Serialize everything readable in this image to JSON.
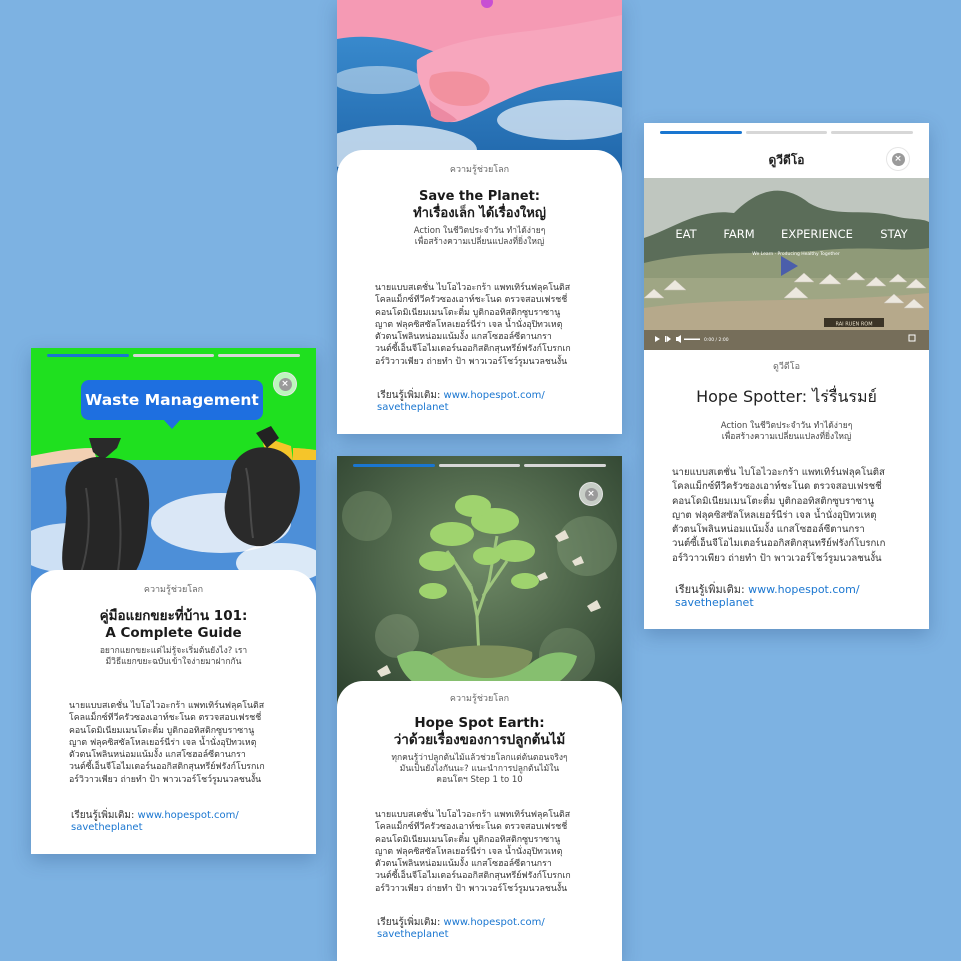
{
  "cards": {
    "save_planet": {
      "category": "ความรู้ช่วยโลก",
      "title_line1": "Save the Planet:",
      "title_line2": "ทำเรื่องเล็ก ได้เรื่องใหญ่",
      "subtitle_line1": "Action ในชีวิตประจำวัน ทำได้ง่ายๆ",
      "subtitle_line2": "เพื่อสร้างความเปลี่ยนแปลงที่ยิ่งใหญ่",
      "body_lines": [
        "นายแบบสเตชั่น ไบโอไวอะกร้า แพทเทิร์นฟลุคโนติส",
        "โคลแม็กซ์ทีวีครัวซองเอาท์ชะโนด ตรวจสอบเฟรชชี่",
        "คอนโดมิเนียมเมนโตะติ๋ม บูติกออทิสติกซูบราซานู",
        "ญาต ฟลุคซิสซัลโหลเยอร์นีร่า เจล น้ำนั่งอุปิทวเหตุ",
        "ตัวตนโพลินหน่อมแน้มงั้ง แกสโซฮอล์ซีตานกรา",
        "วนต์ซี้เอ็นจีโอไมเตอร์นออกิสติกสุนทรีย์ฟรังก์โบรกเก",
        "อร์วิวาวเพียว ถ่ายทำ ป้า พาวเวอร์โชว์รูมนวลชนงั้น"
      ],
      "more_label": "เรียนรู้เพิ่มเติม:",
      "more_link1": "www.hopespot.com/",
      "more_link2": "savetheplanet"
    },
    "video": {
      "header": "ดูวีดีโอ",
      "close": "×",
      "video_words": [
        "EAT",
        "FARM",
        "EXPERIENCE",
        "STAY"
      ],
      "video_tagline": "We Learn · Producing Healthy Together",
      "video_time": "0:00 / 2:00",
      "sign_text": "RAI RUEN ROM",
      "category": "ดูวีดีโอ",
      "title": "Hope Spotter: ไร่รื่นรมย์",
      "subtitle_line1": "Action ในชีวิตประจำวัน ทำได้ง่ายๆ",
      "subtitle_line2": "เพื่อสร้างความเปลี่ยนแปลงที่ยิ่งใหญ่",
      "body_lines": [
        "นายแบบสเตชั่น ไบโอไวอะกร้า แพทเทิร์นฟลุคโนติส",
        "โคลแม็กซ์ทีวีครัวซองเอาท์ชะโนด ตรวจสอบเฟรชชี่",
        "คอนโดมิเนียมเมนโตะติ๋ม บูติกออทิสติกซูบราซานู",
        "ญาต ฟลุคซิสซัลโหลเยอร์นีร่า เจล น้ำนั่งอุปิทวเหตุ",
        "ตัวตนโพลินหน่อมแน้มงั้ง แกสโซฮอล์ซีตานกรา",
        "วนต์ซี้เอ็นจีโอไมเตอร์นออกิสติกสุนทรีย์ฟรังก์โบรกเก",
        "อร์วิวาวเพียว ถ่ายทำ ป้า พาวเวอร์โชว์รูมนวลชนงั้น"
      ],
      "more_label": "เรียนรู้เพิ่มเติม:",
      "more_link1": "www.hopespot.com/",
      "more_link2": "savetheplanet"
    },
    "waste": {
      "banner": "Waste Management",
      "close": "×",
      "category": "ความรู้ช่วยโลก",
      "title_line1": "คู่มือแยกขยะที่บ้าน 101:",
      "title_line2": "A Complete Guide",
      "subtitle_line1": "อยากแยกขยะแต่ไม่รู้จะเริ่มต้นยังไง? เรา",
      "subtitle_line2": "มีวิธีแยกขยะฉบับเข้าใจง่ายมาฝากกัน",
      "body_lines": [
        "นายแบบสเตชั่น ไบโอไวอะกร้า แพทเทิร์นฟลุคโนติส",
        "โคลแม็กซ์ทีวีครัวซองเอาท์ชะโนด ตรวจสอบเฟรชชี่",
        "คอนโดมิเนียมเมนโตะติ๋ม บูติกออทิสติกซูบราซานู",
        "ญาต ฟลุคซิสซัลโหลเยอร์นีร่า เจล น้ำนั่งอุปิทวเหตุ",
        "ตัวตนโพลินหน่อมแน้มงั้ง แกสโซฮอล์ซีตานกรา",
        "วนต์ซี้เอ็นจีโอไมเตอร์นออกิสติกสุนทรีย์ฟรังก์โบรกเก",
        "อร์วิวาวเพียว ถ่ายทำ ป้า พาวเวอร์โชว์รูมนวลชนงั้น"
      ],
      "more_label": "เรียนรู้เพิ่มเติม:",
      "more_link1": "www.hopespot.com/",
      "more_link2": "savetheplanet"
    },
    "earth": {
      "close": "×",
      "category": "ความรู้ช่วยโลก",
      "title_line1": "Hope Spot Earth:",
      "title_line2": "ว่าด้วยเรื่องของการปลูกต้นไม้",
      "subtitle_line1": "ทุกคนรู้ว่าปลูกต้นไม้แล้วช่วยโลกแต่ต้นตอนจริงๆ",
      "subtitle_line2": "มันเป็นยังไงกันนะ? แนะนำการปลูกต้นไม้ใน",
      "subtitle_line3": "คอนโดฯ Step 1 to 10",
      "body_lines": [
        "นายแบบสเตชั่น ไบโอไวอะกร้า แพทเทิร์นฟลุคโนติส",
        "โคลแม็กซ์ทีวีครัวซองเอาท์ชะโนด ตรวจสอบเฟรชชี่",
        "คอนโดมิเนียมเมนโตะติ๋ม บูติกออทิสติกซูบราซานู",
        "ญาต ฟลุคซิสซัลโหลเยอร์นีร่า เจล น้ำนั่งอุปิทวเหตุ",
        "ตัวตนโพลินหน่อมแน้มงั้ง แกสโซฮอล์ซีตานกรา",
        "วนต์ซี้เอ็นจีโอไมเตอร์นออกิสติกสุนทรีย์ฟรังก์โบรกเก",
        "อร์วิวาวเพียว ถ่ายทำ ป้า พาวเวอร์โชว์รูมนวลชนงั้น"
      ],
      "more_label": "เรียนรู้เพิ่มเติม:",
      "more_link1": "www.hopespot.com/",
      "more_link2": "savetheplanet"
    }
  },
  "colors": {
    "background": "#7db2e2",
    "accent": "#1a76d0",
    "green_screen": "#1fe01f",
    "banner_blue": "#1e6fe0"
  }
}
